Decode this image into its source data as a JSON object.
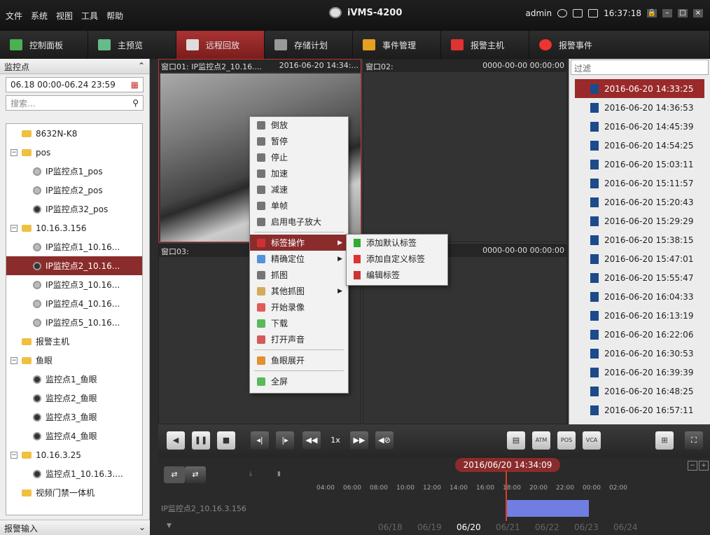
{
  "menu": [
    "文件",
    "系统",
    "视图",
    "工具",
    "帮助"
  ],
  "app_title": "iVMS-4200",
  "user": {
    "name": "admin",
    "time": "16:37:18"
  },
  "tabs": [
    {
      "label": "控制面板"
    },
    {
      "label": "主预览"
    },
    {
      "label": "远程回放"
    },
    {
      "label": "存储计划"
    },
    {
      "label": "事件管理"
    },
    {
      "label": "报警主机"
    },
    {
      "label": "报警事件"
    }
  ],
  "left": {
    "header": "监控点",
    "date_range": "06.18 00:00-06.24 23:59",
    "search_placeholder": "搜索...",
    "footer": "报警输入",
    "tree": [
      {
        "label": "8632N-K8",
        "indent": 1,
        "kind": "folder",
        "expander": ""
      },
      {
        "label": "pos",
        "indent": 0,
        "kind": "folder",
        "expander": "−"
      },
      {
        "label": "IP监控点1_pos",
        "indent": 2,
        "kind": "cam-dim"
      },
      {
        "label": "IP监控点2_pos",
        "indent": 2,
        "kind": "cam-dim"
      },
      {
        "label": "IP监控点32_pos",
        "indent": 2,
        "kind": "cam"
      },
      {
        "label": "10.16.3.156",
        "indent": 0,
        "kind": "folder",
        "expander": "−"
      },
      {
        "label": "IP监控点1_10.16...",
        "indent": 2,
        "kind": "cam-dim"
      },
      {
        "label": "IP监控点2_10.16...",
        "indent": 2,
        "kind": "cam",
        "selected": true
      },
      {
        "label": "IP监控点3_10.16...",
        "indent": 2,
        "kind": "cam-dim"
      },
      {
        "label": "IP监控点4_10.16...",
        "indent": 2,
        "kind": "cam-dim"
      },
      {
        "label": "IP监控点5_10.16...",
        "indent": 2,
        "kind": "cam-dim"
      },
      {
        "label": "报警主机",
        "indent": 1,
        "kind": "folder",
        "expander": ""
      },
      {
        "label": "鱼眼",
        "indent": 0,
        "kind": "folder",
        "expander": "−"
      },
      {
        "label": "监控点1_鱼眼",
        "indent": 2,
        "kind": "cam"
      },
      {
        "label": "监控点2_鱼眼",
        "indent": 2,
        "kind": "cam"
      },
      {
        "label": "监控点3_鱼眼",
        "indent": 2,
        "kind": "cam"
      },
      {
        "label": "监控点4_鱼眼",
        "indent": 2,
        "kind": "cam"
      },
      {
        "label": "10.16.3.25",
        "indent": 0,
        "kind": "folder",
        "expander": "−"
      },
      {
        "label": "监控点1_10.16.3....",
        "indent": 2,
        "kind": "cam"
      },
      {
        "label": "视频门禁一体机",
        "indent": 1,
        "kind": "folder",
        "expander": ""
      }
    ]
  },
  "windows": [
    {
      "title": "窗口01: IP监控点2_10.16....",
      "time": "2016-06-20 14:34:..."
    },
    {
      "title": "窗口02:",
      "time": "0000-00-00 00:00:00"
    },
    {
      "title": "窗口03:",
      "time": ""
    },
    {
      "title": "",
      "time": "0000-00-00 00:00:00"
    }
  ],
  "context_menu": [
    {
      "label": "倒放"
    },
    {
      "label": "暂停"
    },
    {
      "label": "停止"
    },
    {
      "label": "加速"
    },
    {
      "label": "减速"
    },
    {
      "label": "单帧"
    },
    {
      "label": "启用电子放大"
    },
    {
      "label": "标签操作",
      "submenu": true,
      "highlight": true
    },
    {
      "label": "精确定位",
      "submenu": true
    },
    {
      "label": "抓图"
    },
    {
      "label": "其他抓图",
      "submenu": true
    },
    {
      "label": "开始录像"
    },
    {
      "label": "下载"
    },
    {
      "label": "打开声音"
    },
    {
      "label": "鱼眼展开"
    },
    {
      "label": "全屏"
    }
  ],
  "submenu": [
    {
      "label": "添加默认标签"
    },
    {
      "label": "添加自定义标签"
    },
    {
      "label": "编辑标签"
    }
  ],
  "right": {
    "filter_placeholder": "过滤",
    "records": [
      "2016-06-20 14:33:25",
      "2016-06-20 14:36:53",
      "2016-06-20 14:45:39",
      "2016-06-20 14:54:25",
      "2016-06-20 15:03:11",
      "2016-06-20 15:11:57",
      "2016-06-20 15:20:43",
      "2016-06-20 15:29:29",
      "2016-06-20 15:38:15",
      "2016-06-20 15:47:01",
      "2016-06-20 15:55:47",
      "2016-06-20 16:04:33",
      "2016-06-20 16:13:19",
      "2016-06-20 16:22:06",
      "2016-06-20 16:30:53",
      "2016-06-20 16:39:39",
      "2016-06-20 16:48:25",
      "2016-06-20 16:57:11"
    ]
  },
  "playback": {
    "speed": "1x"
  },
  "timeline": {
    "current": "2016/06/20 14:34:09",
    "ticks": [
      "04:00",
      "06:00",
      "08:00",
      "10:00",
      "12:00",
      "14:00",
      "16:00",
      "18:00",
      "20:00",
      "22:00",
      "00:00",
      "02:00"
    ],
    "channel": "IP监控点2_10.16.3.156",
    "days": [
      "06/18",
      "06/19",
      "06/20",
      "06/21",
      "06/22",
      "06/23",
      "06/24"
    ],
    "current_day": "06/20"
  }
}
